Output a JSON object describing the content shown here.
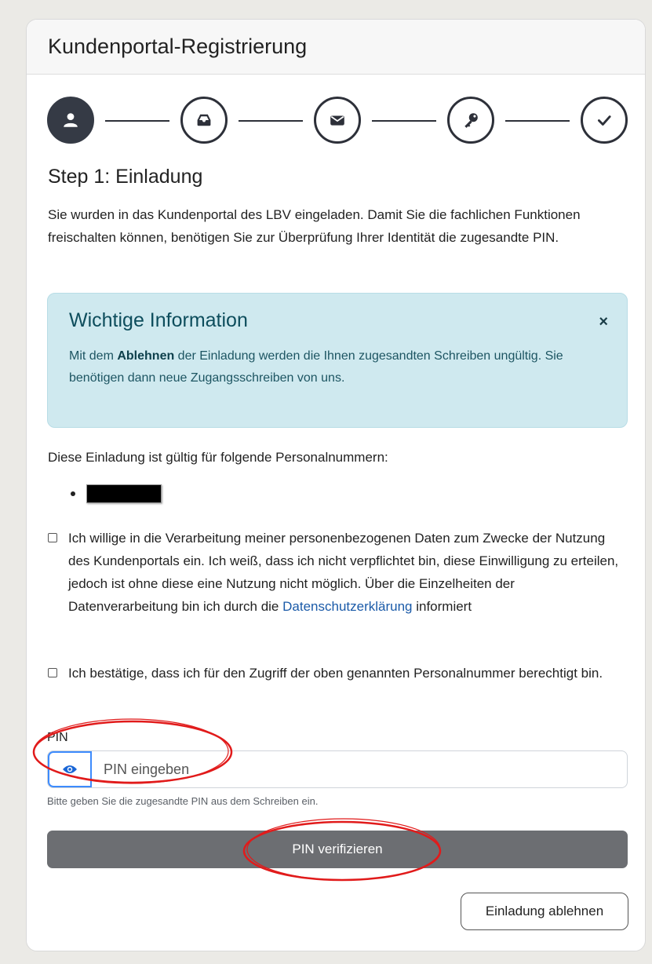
{
  "header": {
    "title": "Kundenportal-Registrierung"
  },
  "stepper": {
    "steps": [
      {
        "icon": "user-icon",
        "active": true
      },
      {
        "icon": "inbox-icon",
        "active": false
      },
      {
        "icon": "envelope-icon",
        "active": false
      },
      {
        "icon": "key-icon",
        "active": false
      },
      {
        "icon": "check-icon",
        "active": false
      }
    ]
  },
  "step": {
    "title": "Step 1: Einladung",
    "intro": "Sie wurden in das Kundenportal des LBV eingeladen. Damit Sie die fachlichen Funktionen freischalten können, benötigen Sie zur Überprüfung Ihrer Identität die zugesandte PIN."
  },
  "alert": {
    "title": "Wichtige Information",
    "close": "×",
    "text_before": "Mit dem ",
    "text_bold": "Ablehnen",
    "text_after": " der Einladung werden die Ihnen zugesandten Schreiben ungültig. Sie benötigen dann neue Zugangsschreiben von uns."
  },
  "personal_numbers": {
    "label": "Diese Einladung ist gültig für folgende Personalnummern:"
  },
  "consent": {
    "text_before": "Ich willige in die Verarbeitung meiner personenbezogenen Daten zum Zwecke der Nutzung des Kundenportals ein. Ich weiß, dass ich nicht verpflichtet bin, diese Einwilligung zu erteilen, jedoch ist ohne diese eine Nutzung nicht möglich. Über die Einzelheiten der Datenverarbeitung bin ich durch die ",
    "link": "Datenschutzerklärung",
    "text_after": " informiert",
    "checked": false
  },
  "confirm": {
    "text": "Ich bestätige, dass ich für den Zugriff der oben genannten Personalnummer berechtigt bin.",
    "checked": false
  },
  "pin": {
    "label": "PIN",
    "placeholder": "PIN eingeben",
    "value": "",
    "hint": "Bitte geben Sie die zugesandte PIN aus dem Schreiben ein."
  },
  "buttons": {
    "verify": "PIN verifizieren",
    "decline": "Einladung ablehnen"
  },
  "colors": {
    "alert_bg": "#cfe9ef",
    "primary_disabled": "#6c6e72",
    "annotation_red": "#e11b1b",
    "focus_blue": "#3d8bfd"
  }
}
